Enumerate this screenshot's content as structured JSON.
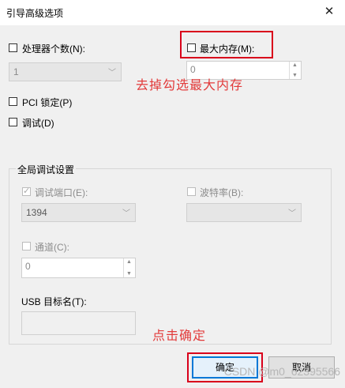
{
  "window": {
    "title": "引导高级选项",
    "close_glyph": "✕"
  },
  "options": {
    "cpu_count_label": "处理器个数(N):",
    "cpu_count_value": "1",
    "max_memory_label": "最大内存(M):",
    "max_memory_value": "0",
    "pci_lock_label": "PCI 锁定(P)",
    "debug_label": "调试(D)"
  },
  "global_debug": {
    "group_title": "全局调试设置",
    "debug_port_label": "调试端口(E):",
    "debug_port_value": "1394",
    "baud_rate_label": "波特率(B):",
    "baud_rate_value": "",
    "channel_label": "通道(C):",
    "channel_value": "0",
    "usb_target_label": "USB 目标名(T):",
    "usb_target_value": ""
  },
  "annotations": {
    "uncheck_memory": "去掉勾选最大内存",
    "click_ok": "点击确定",
    "color": "#e23a3a"
  },
  "buttons": {
    "ok": "确定",
    "cancel": "取消"
  },
  "watermark": "CSDN @m0_62395566"
}
